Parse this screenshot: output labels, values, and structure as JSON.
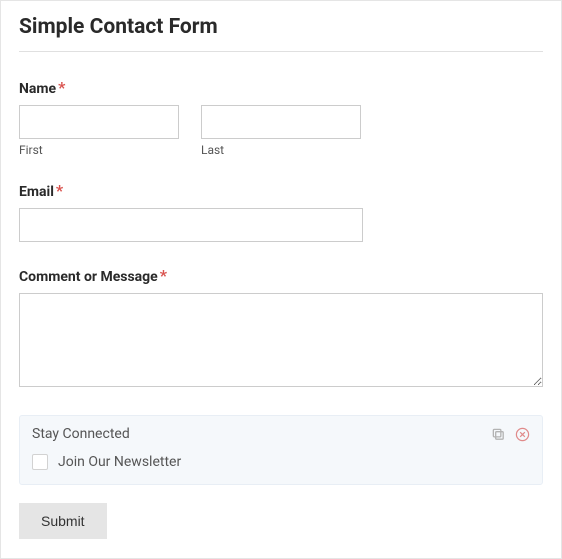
{
  "title": "Simple Contact Form",
  "name": {
    "label": "Name",
    "required": "*",
    "first_sub": "First",
    "last_sub": "Last"
  },
  "email": {
    "label": "Email",
    "required": "*"
  },
  "comment": {
    "label": "Comment or Message",
    "required": "*"
  },
  "stay": {
    "title": "Stay Connected",
    "checkbox_label": "Join Our Newsletter"
  },
  "submit_label": "Submit"
}
